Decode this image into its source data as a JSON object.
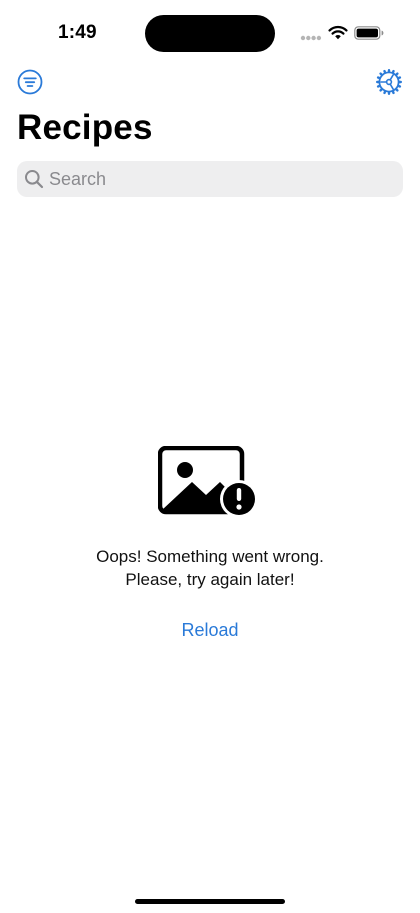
{
  "status_bar": {
    "time": "1:49",
    "signal_icon": "signal-dots-icon",
    "wifi_icon": "wifi-icon",
    "battery_icon": "battery-full-icon"
  },
  "nav": {
    "left_icon": "filter-circle-icon",
    "right_icon": "gear-icon",
    "accent_color": "#2a7ad8"
  },
  "page": {
    "title": "Recipes"
  },
  "search": {
    "placeholder": "Search",
    "value": ""
  },
  "error_state": {
    "icon": "photo-exclamation-icon",
    "message_line1": "Oops! Something went wrong.",
    "message_line2": "Please, try again later!",
    "reload_label": "Reload"
  }
}
